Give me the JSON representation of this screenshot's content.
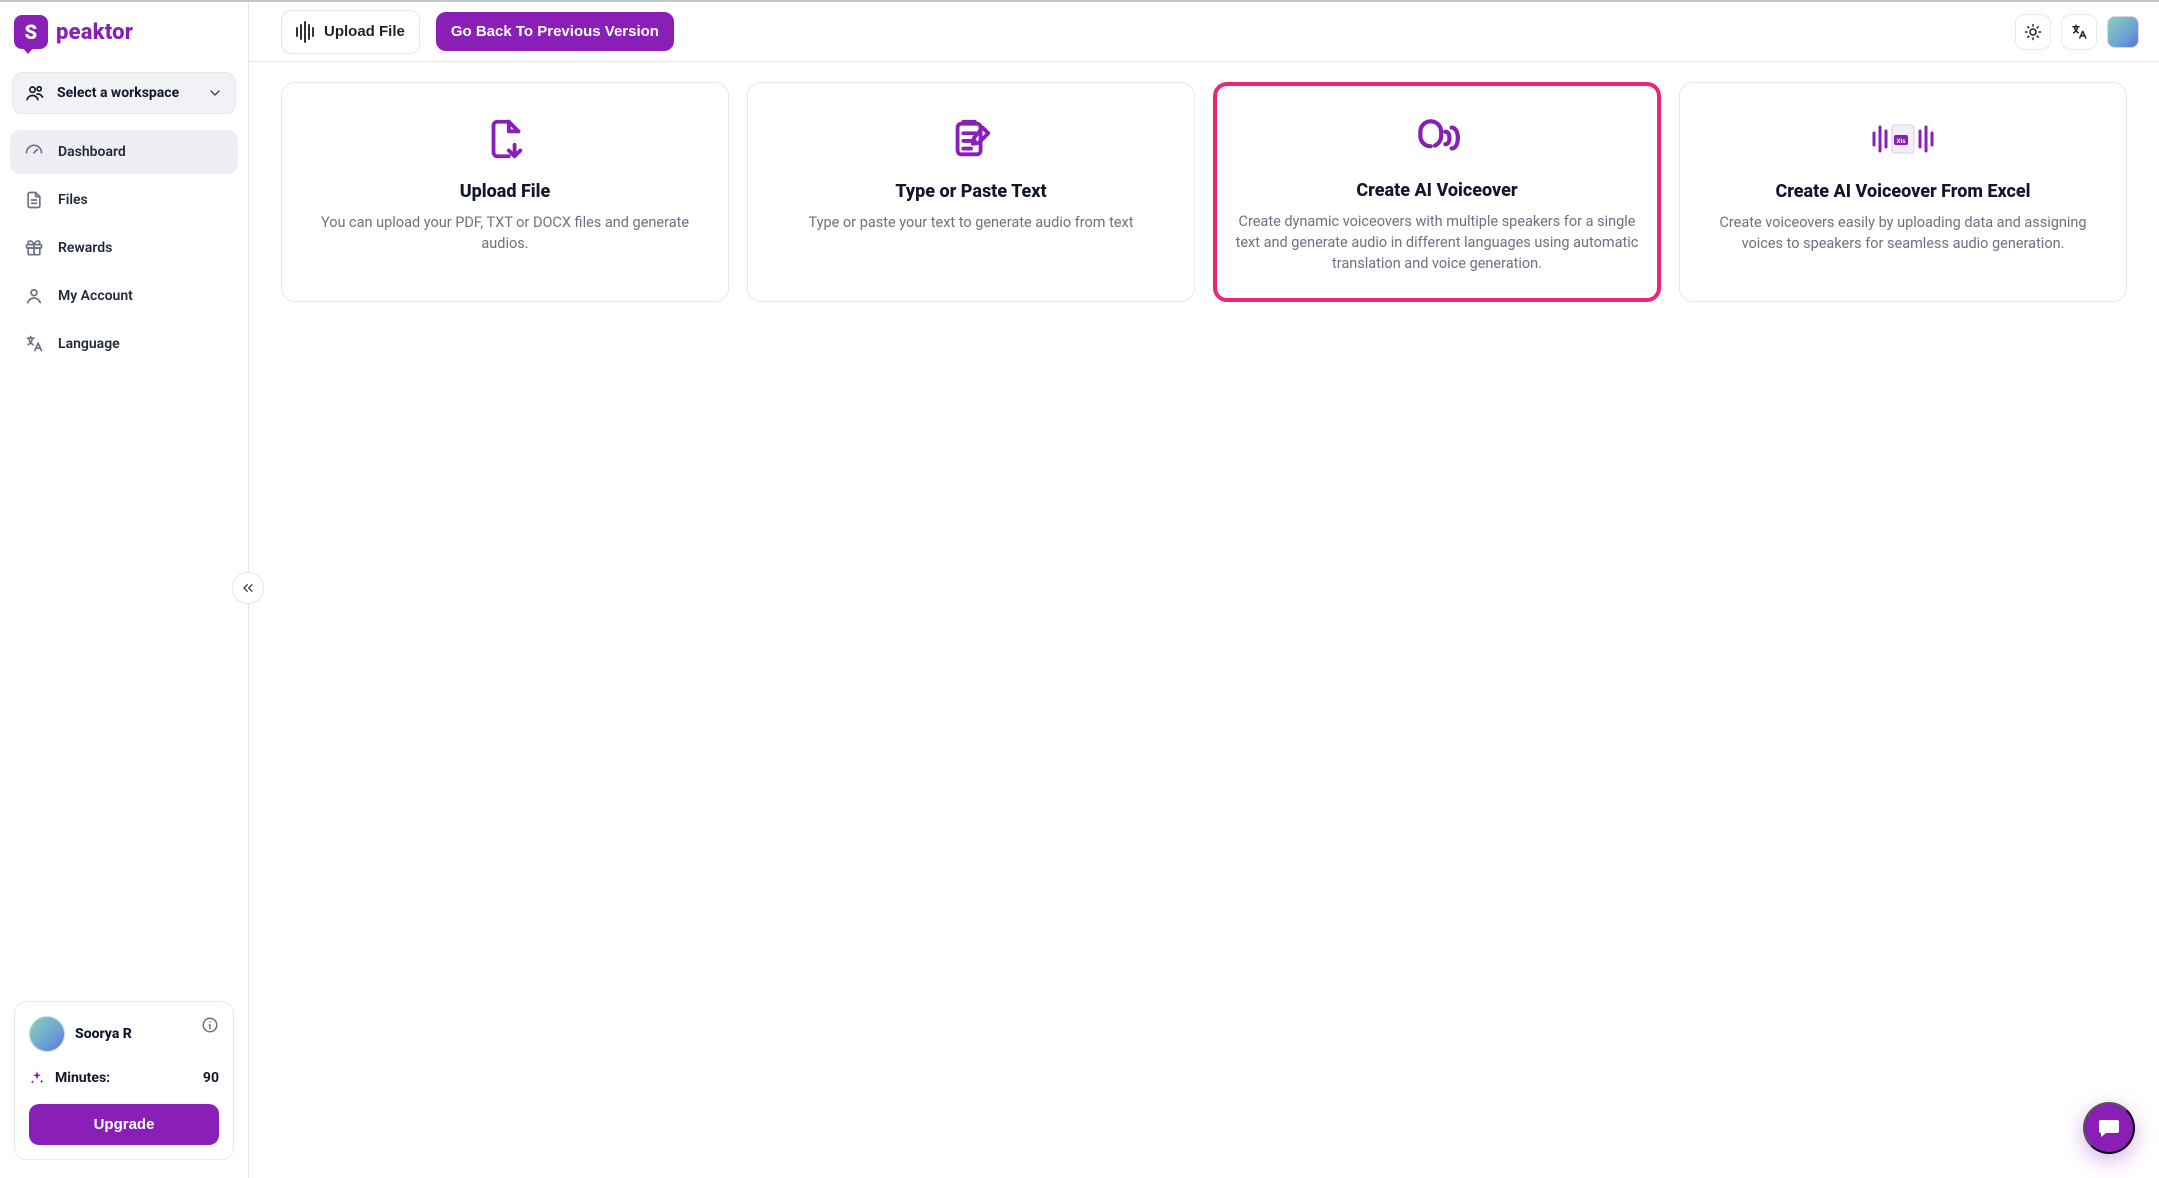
{
  "brand": {
    "name": "Speaktor",
    "mark": "S"
  },
  "workspace": {
    "label": "Select a workspace"
  },
  "sidebar": {
    "items": [
      {
        "label": "Dashboard",
        "icon": "gauge-icon",
        "active": true
      },
      {
        "label": "Files",
        "icon": "file-icon",
        "active": false
      },
      {
        "label": "Rewards",
        "icon": "gift-icon",
        "active": false
      },
      {
        "label": "My Account",
        "icon": "user-icon",
        "active": false
      },
      {
        "label": "Language",
        "icon": "translate-icon",
        "active": false
      }
    ]
  },
  "plan": {
    "user_name": "Soorya R",
    "minutes_label": "Minutes:",
    "minutes_value": "90",
    "upgrade_label": "Upgrade"
  },
  "topbar": {
    "upload_label": "Upload File",
    "go_back_label": "Go Back To Previous Version"
  },
  "cards": [
    {
      "title": "Upload File",
      "desc": "You can upload your PDF, TXT or DOCX files and generate audios.",
      "icon": "upload-file-icon",
      "highlight": false
    },
    {
      "title": "Type or Paste Text",
      "desc": "Type or paste your text to generate audio from text",
      "icon": "paste-text-icon",
      "highlight": false
    },
    {
      "title": "Create AI Voiceover",
      "desc": "Create dynamic voiceovers with multiple speakers for a single text and generate audio in different languages using automatic translation and voice generation.",
      "icon": "ai-voiceover-icon",
      "highlight": true
    },
    {
      "title": "Create AI Voiceover From Excel",
      "desc": "Create voiceovers easily by uploading data and assigning voices to speakers for seamless audio generation.",
      "icon": "excel-voiceover-icon",
      "highlight": false
    }
  ],
  "colors": {
    "purple": "#8a1fb8",
    "highlight": "#ec247a"
  }
}
